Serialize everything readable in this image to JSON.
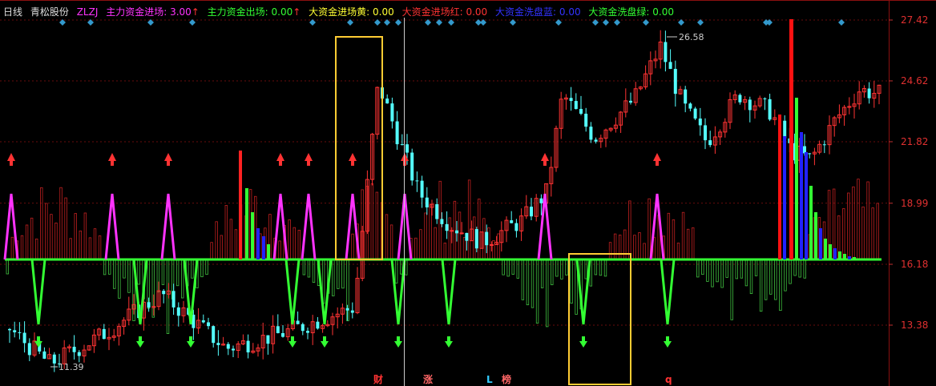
{
  "header": {
    "period": "日线",
    "stock_name": "青松股份",
    "items": [
      {
        "label": "ZLZJ",
        "color": "#ff33ff"
      },
      {
        "label": "主力资金进场:",
        "value": "3.00",
        "arrow": "↑",
        "color": "#ff33ff",
        "arrow_color": "#ff3333"
      },
      {
        "label": "主力资金出场:",
        "value": "0.00",
        "arrow": "↑",
        "color": "#33ff33",
        "arrow_color": "#ff3333"
      },
      {
        "label": "大资金进场黄:",
        "value": "0.00",
        "color": "#ffff33"
      },
      {
        "label": "大资金进场红:",
        "value": "0.00",
        "color": "#ff3333"
      },
      {
        "label": "大资金洗盘蓝:",
        "value": "0.00",
        "color": "#3333ff"
      },
      {
        "label": "大资金洗盘绿:",
        "value": "0.00",
        "color": "#33ff33"
      }
    ]
  },
  "price_axis": [
    "27.42",
    "24.62",
    "21.82",
    "18.99",
    "16.18",
    "13.38"
  ],
  "annotations": {
    "high": "26.58",
    "low": "11.39"
  },
  "bottom_marks": [
    {
      "text": "财",
      "color": "#ff3333"
    },
    {
      "text": "涨",
      "color": "#ff6666"
    },
    {
      "text": "L",
      "color": "#33ccff"
    },
    {
      "text": "榜",
      "color": "#ff6666"
    },
    {
      "text": "q",
      "color": "#ff3333"
    }
  ],
  "colors": {
    "up": "#ff3333",
    "down": "#54ffff",
    "baseline": "#33ff33",
    "magenta": "#ff33ff",
    "blue": "#2222ff",
    "green": "#33ff33",
    "yellow_box": "#ffcc33",
    "grid": "#8b1010",
    "diamond": "#3399cc"
  },
  "chart_data": {
    "type": "candlestick",
    "y_ticks": [
      27.42,
      24.62,
      21.82,
      18.99,
      16.18,
      13.38
    ],
    "ylim": [
      11.0,
      28.2
    ],
    "high_point": 26.58,
    "low_point": 11.39,
    "grid": true
  }
}
